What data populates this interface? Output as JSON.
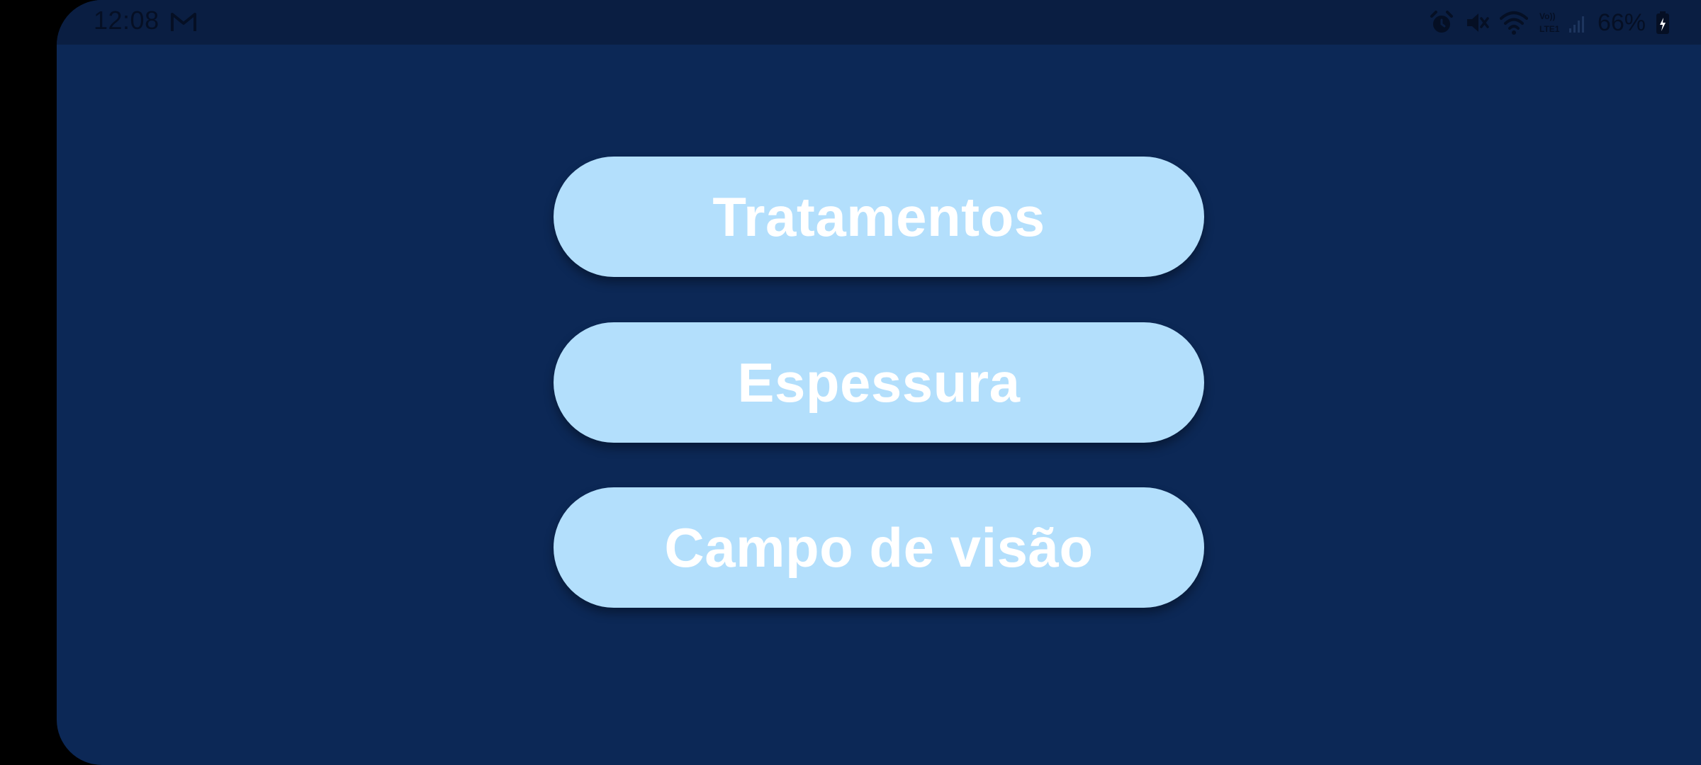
{
  "status_bar": {
    "time": "12:08",
    "battery_percent": "66%",
    "network_label": "LTE1",
    "icons": [
      "gmail-icon",
      "alarm-icon",
      "mute-icon",
      "wifi-icon",
      "volte-signal-icon",
      "battery-icon"
    ]
  },
  "menu": {
    "buttons": [
      {
        "label": "Tratamentos"
      },
      {
        "label": "Espessura"
      },
      {
        "label": "Campo de visão"
      }
    ]
  },
  "colors": {
    "background": "#0c2856",
    "status_bar": "#0a1e42",
    "button_fill": "#b3dffc",
    "button_text": "#ffffff"
  }
}
